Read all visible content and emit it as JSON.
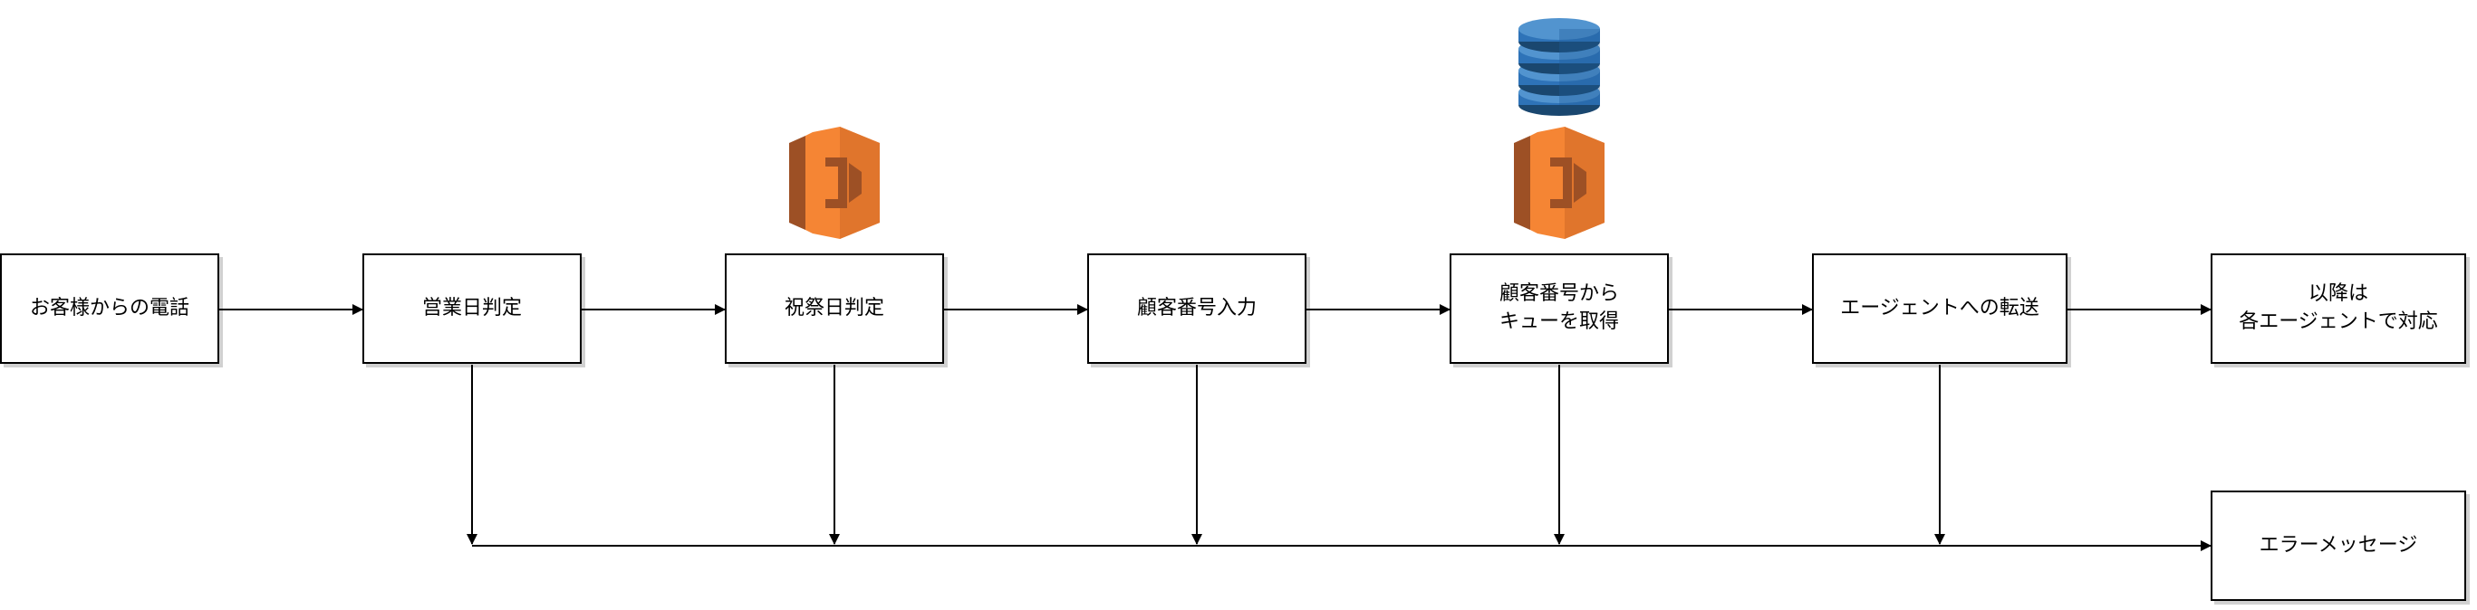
{
  "diagram": {
    "nodes": [
      {
        "id": "call",
        "lines": [
          "お客様からの電話"
        ]
      },
      {
        "id": "business-day",
        "lines": [
          "営業日判定"
        ]
      },
      {
        "id": "holiday",
        "lines": [
          "祝祭日判定"
        ]
      },
      {
        "id": "customer-number",
        "lines": [
          "顧客番号入力"
        ]
      },
      {
        "id": "queue",
        "lines": [
          "顧客番号から",
          "キューを取得"
        ]
      },
      {
        "id": "transfer",
        "lines": [
          "エージェントへの転送"
        ]
      },
      {
        "id": "agent",
        "lines": [
          "以降は",
          "各エージェントで対応"
        ]
      },
      {
        "id": "error",
        "lines": [
          "エラーメッセージ"
        ]
      }
    ],
    "icons": [
      {
        "id": "lambda-holiday",
        "kind": "aws-lambda-icon",
        "color": "#F58534"
      },
      {
        "id": "lambda-queue",
        "kind": "aws-lambda-icon",
        "color": "#F58534"
      },
      {
        "id": "dynamodb",
        "kind": "aws-dynamodb-icon",
        "color": "#2E73B8"
      }
    ],
    "edges": [
      [
        "call",
        "business-day"
      ],
      [
        "business-day",
        "holiday"
      ],
      [
        "holiday",
        "customer-number"
      ],
      [
        "customer-number",
        "queue"
      ],
      [
        "queue",
        "transfer"
      ],
      [
        "transfer",
        "agent"
      ],
      [
        "business-day",
        "error"
      ],
      [
        "holiday",
        "error"
      ],
      [
        "customer-number",
        "error"
      ],
      [
        "queue",
        "error"
      ],
      [
        "transfer",
        "error"
      ]
    ]
  }
}
